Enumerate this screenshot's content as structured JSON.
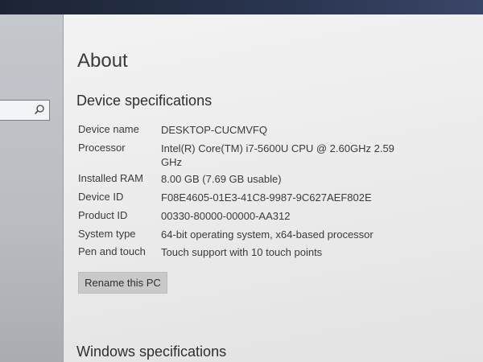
{
  "nav": {
    "search_icon": "search-icon"
  },
  "page": {
    "title": "About"
  },
  "device_specs": {
    "title": "Device specifications",
    "rows": [
      {
        "label": "Device name",
        "value": "DESKTOP-CUCMVFQ"
      },
      {
        "label": "Processor",
        "value": "Intel(R) Core(TM) i7-5600U CPU @ 2.60GHz   2.59 GHz"
      },
      {
        "label": "Installed RAM",
        "value": "8.00 GB (7.69 GB usable)"
      },
      {
        "label": "Device ID",
        "value": "F08E4605-01E3-41C8-9987-9C627AEF802E"
      },
      {
        "label": "Product ID",
        "value": "00330-80000-00000-AA312"
      },
      {
        "label": "System type",
        "value": "64-bit operating system, x64-based processor"
      },
      {
        "label": "Pen and touch",
        "value": "Touch support with 10 touch points"
      }
    ],
    "rename_button": "Rename this PC"
  },
  "windows_specs": {
    "title": "Windows specifications"
  }
}
